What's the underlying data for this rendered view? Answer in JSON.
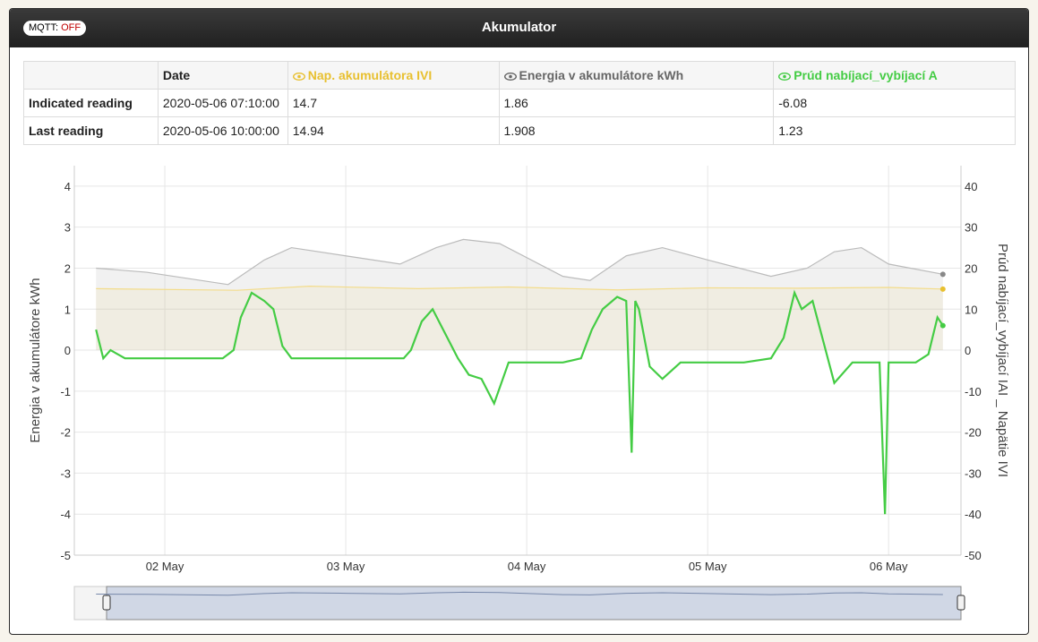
{
  "header": {
    "title": "Akumulator",
    "mqtt_label": "MQTT:",
    "mqtt_state": "OFF"
  },
  "table": {
    "columns": {
      "date": "Date",
      "voltage": "Nap. akumulátora IVI",
      "energy": "Energia v akumulátore kWh",
      "current": "Prúd nabíjací_vybíjací A"
    },
    "rows": [
      {
        "label": "Indicated reading",
        "date": "2020-05-06 07:10:00",
        "voltage": "14.7",
        "energy": "1.86",
        "current": "-6.08"
      },
      {
        "label": "Last reading",
        "date": "2020-05-06 10:00:00",
        "voltage": "14.94",
        "energy": "1.908",
        "current": "1.23"
      }
    ]
  },
  "colors": {
    "voltage": "#e8c030",
    "energy": "#888888",
    "current": "#44cc44",
    "mqtt_off": "#c00000"
  },
  "icons": {
    "series_toggle": "eye-icon"
  },
  "chart_data": {
    "type": "area",
    "x_ticks": [
      "02 May",
      "03 May",
      "04 May",
      "05 May",
      "06 May"
    ],
    "left_axis": {
      "label": "Energia v akumulátore kWh",
      "range": [
        -5,
        4.5
      ],
      "ticks": [
        4,
        3,
        2,
        1,
        0,
        -1,
        -2,
        -3,
        -4,
        -5
      ]
    },
    "right_axis": {
      "label": "Prúd nabíjací_vybíjací IAI _ Napätie IVI",
      "range": [
        -50,
        45
      ],
      "ticks": [
        40,
        30,
        20,
        10,
        0,
        -10,
        -20,
        -30,
        -40,
        -50
      ]
    },
    "grid": true,
    "series": [
      {
        "name": "Energia v akumulátore kWh",
        "axis": "left",
        "x": [
          1.62,
          1.9,
          2.35,
          2.55,
          2.7,
          3.0,
          3.3,
          3.5,
          3.65,
          3.85,
          4.2,
          4.35,
          4.55,
          4.75,
          5.0,
          5.35,
          5.55,
          5.7,
          5.85,
          6.0,
          6.3
        ],
        "values": [
          2.0,
          1.9,
          1.6,
          2.2,
          2.5,
          2.3,
          2.1,
          2.5,
          2.7,
          2.6,
          1.8,
          1.7,
          2.3,
          2.5,
          2.2,
          1.8,
          2.0,
          2.4,
          2.5,
          2.1,
          1.85
        ]
      },
      {
        "name": "Nap. akumulátora IVI",
        "axis": "right",
        "x": [
          1.62,
          2.4,
          2.8,
          3.4,
          3.9,
          4.5,
          5.0,
          5.5,
          6.0,
          6.3
        ],
        "values": [
          15.0,
          14.6,
          15.6,
          15.0,
          15.4,
          14.7,
          15.2,
          15.1,
          15.3,
          14.9
        ]
      },
      {
        "name": "Prúd nabíjací_vybíjací A",
        "axis": "right",
        "x": [
          1.62,
          1.66,
          1.7,
          1.78,
          1.85,
          2.0,
          2.2,
          2.32,
          2.38,
          2.42,
          2.48,
          2.55,
          2.6,
          2.65,
          2.7,
          2.75,
          2.82,
          3.0,
          3.2,
          3.32,
          3.36,
          3.42,
          3.48,
          3.55,
          3.62,
          3.68,
          3.75,
          3.82,
          3.9,
          4.0,
          4.2,
          4.3,
          4.36,
          4.42,
          4.5,
          4.55,
          4.58,
          4.6,
          4.62,
          4.68,
          4.75,
          4.85,
          5.0,
          5.2,
          5.35,
          5.42,
          5.48,
          5.52,
          5.58,
          5.64,
          5.7,
          5.8,
          5.95,
          5.98,
          6.0,
          6.05,
          6.15,
          6.22,
          6.27,
          6.3
        ],
        "values": [
          5.0,
          -2.0,
          0.0,
          -2.0,
          -2.0,
          -2.0,
          -2.0,
          -2.0,
          0.0,
          8.0,
          14.0,
          12.0,
          10.0,
          1.0,
          -2.0,
          -2.0,
          -2.0,
          -2.0,
          -2.0,
          -2.0,
          0.0,
          7.0,
          10.0,
          4.0,
          -2.0,
          -6.0,
          -7.0,
          -13.0,
          -3.0,
          -3.0,
          -3.0,
          -2.0,
          5.0,
          10.0,
          13.0,
          12.0,
          -25.0,
          12.0,
          10.0,
          -4.0,
          -7.0,
          -3.0,
          -3.0,
          -3.0,
          -2.0,
          3.0,
          14.0,
          10.0,
          12.0,
          2.0,
          -8.0,
          -3.0,
          -3.0,
          -40.0,
          -3.0,
          -3.0,
          -3.0,
          -1.0,
          8.0,
          6.0
        ]
      }
    ]
  }
}
